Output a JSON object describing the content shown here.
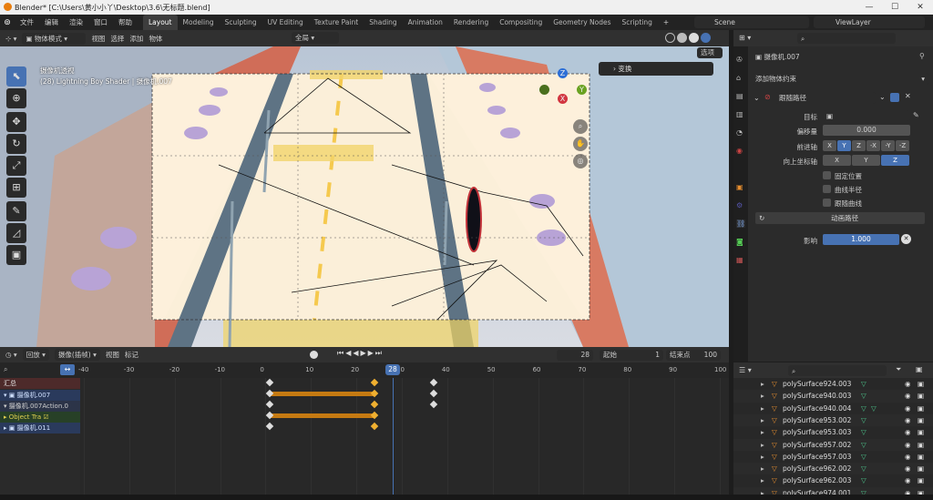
{
  "titlebar": {
    "title": "Blender* [C:\\Users\\黄小小丫\\Desktop\\3.6\\无标题.blend]",
    "minimize": "—",
    "maximize": "☐",
    "close": "✕"
  },
  "menu": {
    "items": [
      "文件",
      "编辑",
      "渲染",
      "窗口",
      "帮助"
    ],
    "workspaces": [
      "Layout",
      "Modeling",
      "Sculpting",
      "UV Editing",
      "Texture Paint",
      "Shading",
      "Animation",
      "Rendering",
      "Compositing",
      "Geometry Nodes",
      "Scripting"
    ],
    "active_workspace": "Layout",
    "scene": "Scene",
    "viewlayer": "ViewLayer"
  },
  "viewport": {
    "mode": "物体模式",
    "menus": [
      "视图",
      "选择",
      "添加",
      "物体"
    ],
    "orientation": "全局",
    "info_line1": "摄像机透视",
    "info_line2": "(28) Lightning Boy Shader | 摄像机.007",
    "transform_panel": "变换",
    "gizmo": {
      "x": "X",
      "y": "Y",
      "z": "Z"
    },
    "select_label": "选项"
  },
  "dopesheet": {
    "editor": "回放",
    "mode": "摄像(插帧)",
    "menus": [
      "视图",
      "标记"
    ],
    "current_frame": "28",
    "start_label": "起始",
    "start": "1",
    "end_label": "结束点",
    "end": "100",
    "ruler_ticks": [
      "-40",
      "-30",
      "-20",
      "-10",
      "0",
      "10",
      "20",
      "30",
      "40",
      "50",
      "60",
      "70",
      "80",
      "90",
      "100"
    ],
    "playhead_label": "28",
    "channels": [
      "汇总",
      "摄像机.007",
      "摄像机.007Action.0",
      "Object Tra",
      "摄像机.011"
    ]
  },
  "properties": {
    "object_name": "摄像机.007",
    "add_constraint": "添加物体约束",
    "constraint_name": "跟随路径",
    "target_label": "目标",
    "offset_label": "偏移量",
    "offset_value": "0.000",
    "forward_label": "前进轴",
    "forward_axes": [
      "X",
      "Y",
      "Z",
      "-X",
      "-Y",
      "-Z"
    ],
    "up_label": "向上坐标轴",
    "up_axes": [
      "X",
      "Y",
      "Z"
    ],
    "fixed_position": "固定位置",
    "curve_radius": "曲线半径",
    "follow_curve": "跟随曲线",
    "animate_path": "动画路径",
    "influence_label": "影响",
    "influence_value": "1.000"
  },
  "outliner": {
    "rows": [
      "polySurface924.003",
      "polySurface940.003",
      "polySurface940.004",
      "polySurface953.002",
      "polySurface953.003",
      "polySurface957.002",
      "polySurface957.003",
      "polySurface962.002",
      "polySurface962.003",
      "polySurface974.001"
    ]
  },
  "colors": {
    "accent": "#4772b3",
    "keyframe_bar": "#c57a12",
    "active_ws": "#3d3d3d"
  }
}
